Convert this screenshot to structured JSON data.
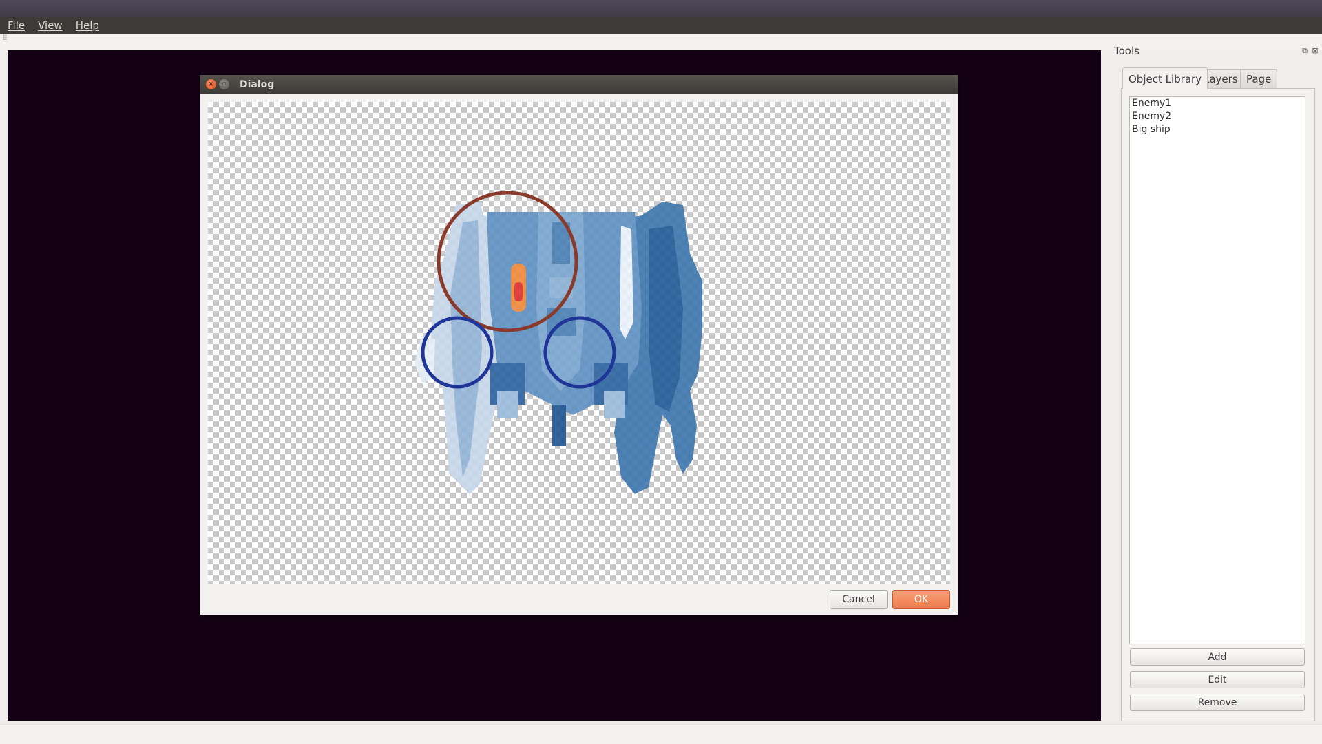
{
  "menubar": {
    "items": [
      "File",
      "View",
      "Help"
    ]
  },
  "dialog": {
    "title": "Dialog",
    "cancel_label": "Cancel",
    "ok_label": "OK"
  },
  "tools": {
    "title": "Tools",
    "tabs": [
      "Object Library",
      "Layers",
      "Page"
    ],
    "active_tab": "Object Library",
    "items": [
      "Enemy1",
      "Enemy2",
      "Big ship"
    ],
    "add_label": "Add",
    "edit_label": "Edit",
    "remove_label": "Remove"
  },
  "colors": {
    "accent": "#ef7b4a",
    "canvas_background": "#140015",
    "hitbox_main": "#8a3a2a",
    "hitbox_secondary": "#1f3597",
    "ship_body": "#5b8ec0"
  },
  "icons": {
    "sprite": "spaceship-sprite",
    "dialog_close": "close-icon",
    "dialog_maximize": "maximize-icon",
    "panel_float": "float-icon",
    "panel_close": "close-icon"
  }
}
